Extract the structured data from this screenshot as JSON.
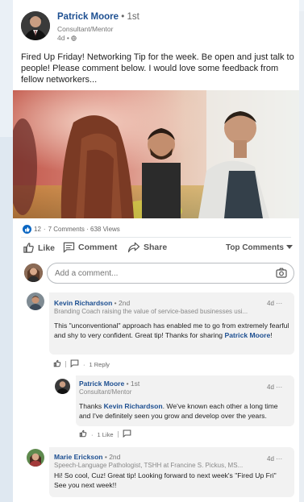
{
  "post": {
    "author_name": "Patrick Moore",
    "degree": "1st",
    "author_title": "Consultant/Mentor",
    "age": "4d",
    "text": "Fired Up Friday! Networking Tip for the week. Be open and just talk to people! Please comment below. I would love some feedback from fellow networkers...",
    "image_icon": "photo-of-people-networking"
  },
  "social": {
    "reactions": "12",
    "summary": "7 Comments · 638 Views"
  },
  "actions": {
    "like": "Like",
    "comment": "Comment",
    "share": "Share",
    "sort": "Top Comments"
  },
  "comment_box": {
    "placeholder": "Add a comment..."
  },
  "comments": [
    {
      "name": "Kevin Richardson",
      "degree": "2nd",
      "headline": "Branding Coach raising the value of service-based businesses usi...",
      "time": "4d",
      "text_before": "This \"unconventional\" approach has enabled me to go from extremely fearful and shy to very confident. Great tip! Thanks for sharing ",
      "mention": "Patrick Moore",
      "text_after": "!",
      "reply_count": "1 Reply",
      "reply": {
        "name": "Patrick Moore",
        "degree": "1st",
        "headline": "Consultant/Mentor",
        "time": "4d",
        "text_before": "Thanks ",
        "mention": "Kevin Richardson",
        "text_after": ". We've known each other a long time and I've definitely seen you grow and develop over the years.",
        "like_count": "1 Like"
      }
    },
    {
      "name": "Marie Erickson",
      "degree": "2nd",
      "headline": "Speech-Language Pathologist, TSHH at Francine S. Pickus, MS...",
      "time": "4d",
      "text": "Hi! So cool, Cuz! Great tip! Looking forward to next week's \"Fired Up Fri\" See you next week!!"
    }
  ],
  "colors": {
    "link_blue": "#1d4f91",
    "like_blue": "#0a66c2"
  }
}
